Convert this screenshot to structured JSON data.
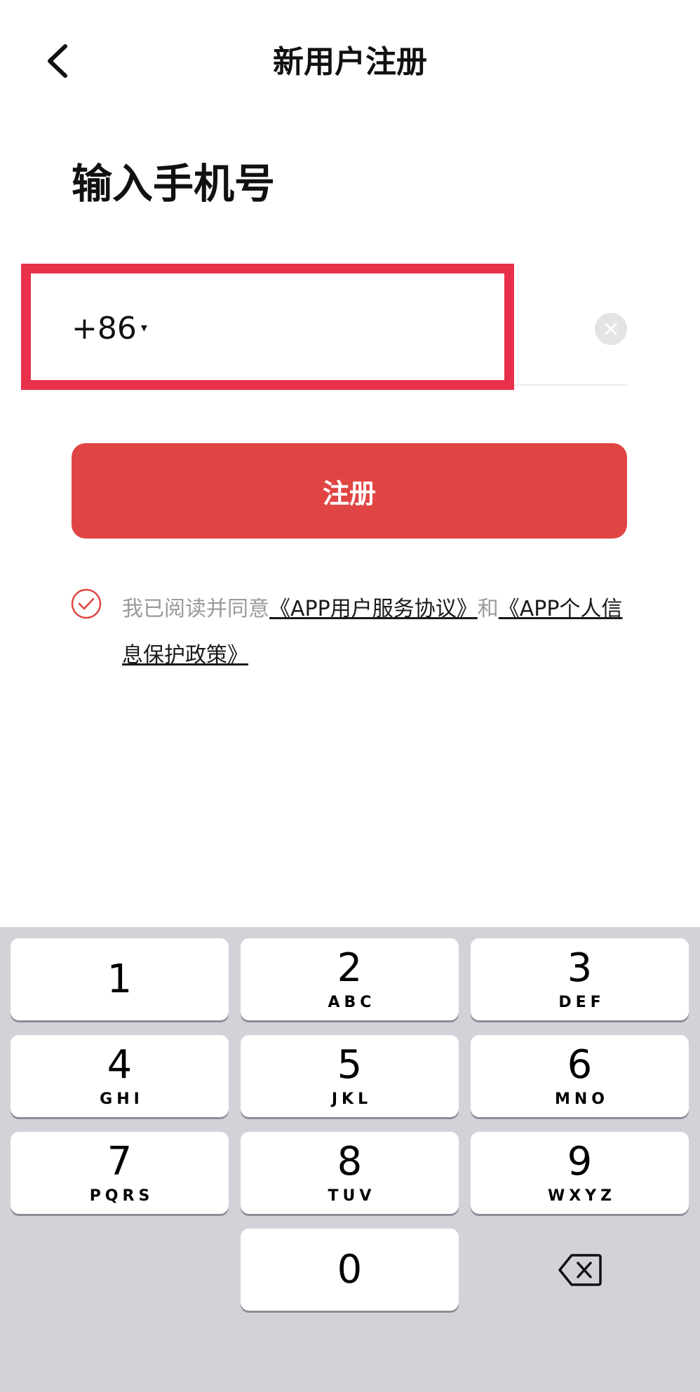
{
  "header": {
    "title": "新用户注册"
  },
  "heading": "输入手机号",
  "phone": {
    "country_code": "+86",
    "caret": "▾",
    "value": "",
    "placeholder": ""
  },
  "register_button": "注册",
  "agreement": {
    "prefix": "我已阅读并同意",
    "link1": "《APP用户服务协议》",
    "conj": "和",
    "link2": "《APP个人信息保护政策》",
    "checked": true,
    "accent": "#e04543"
  },
  "keypad": {
    "keys": [
      {
        "num": "1",
        "letters": ""
      },
      {
        "num": "2",
        "letters": "ABC"
      },
      {
        "num": "3",
        "letters": "DEF"
      },
      {
        "num": "4",
        "letters": "GHI"
      },
      {
        "num": "5",
        "letters": "JKL"
      },
      {
        "num": "6",
        "letters": "MNO"
      },
      {
        "num": "7",
        "letters": "PQRS"
      },
      {
        "num": "8",
        "letters": "TUV"
      },
      {
        "num": "9",
        "letters": "WXYZ"
      },
      {
        "num": "0",
        "letters": ""
      }
    ],
    "delete_icon": "backspace-icon"
  },
  "colors": {
    "highlight": "#e9304b",
    "button": "#e04543",
    "keypad_bg": "#d1d3d9"
  }
}
